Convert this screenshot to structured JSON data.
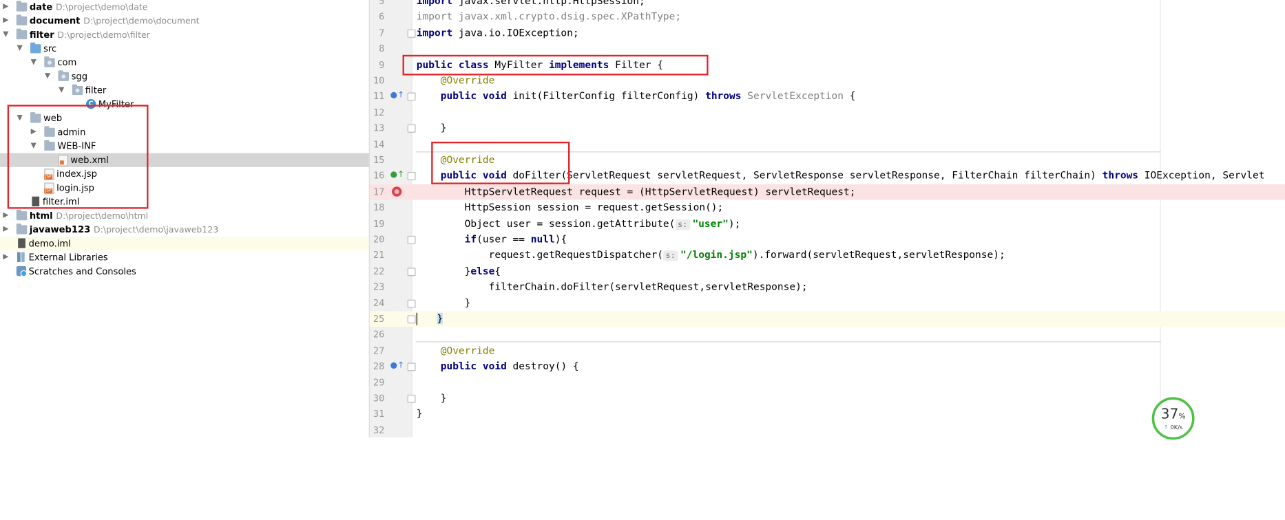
{
  "tree": [
    {
      "type": "module",
      "name": "date",
      "path": "D:\\project\\demo\\date"
    },
    {
      "type": "module",
      "name": "document",
      "path": "D:\\project\\demo\\document"
    },
    {
      "type": "module",
      "name": "filter",
      "path": "D:\\project\\demo\\filter"
    },
    {
      "label": "src"
    },
    {
      "label": "com"
    },
    {
      "label": "sgg"
    },
    {
      "label": "filter"
    },
    {
      "label": "MyFilter"
    },
    {
      "label": "web"
    },
    {
      "label": "admin"
    },
    {
      "label": "WEB-INF"
    },
    {
      "label": "web.xml"
    },
    {
      "label": "index.jsp"
    },
    {
      "label": "login.jsp"
    },
    {
      "label": "filter.iml"
    },
    {
      "type": "module",
      "name": "html",
      "path": "D:\\project\\demo\\html"
    },
    {
      "type": "module",
      "name": "javaweb123",
      "path": "D:\\project\\demo\\javaweb123"
    },
    {
      "label": "demo.iml"
    },
    {
      "label": "External Libraries"
    },
    {
      "label": "Scratches and Consoles"
    }
  ],
  "code": {
    "line_numbers": [
      "5",
      "6",
      "7",
      "8",
      "9",
      "10",
      "11",
      "12",
      "13",
      "14",
      "15",
      "16",
      "17",
      "18",
      "19",
      "20",
      "21",
      "22",
      "23",
      "24",
      "25",
      "26",
      "27",
      "28",
      "29",
      "30",
      "31",
      "32"
    ],
    "l5": {
      "kw": "import",
      "rest": " javax.servlet.http.HttpSession;"
    },
    "l6": {
      "kw": "import",
      "rest": " javax.xml.crypto.dsig.spec.XPathType;"
    },
    "l7": {
      "kw": "import",
      "rest": " java.io.IOException;"
    },
    "l9": {
      "kw1": "public class",
      "name": " MyFilter ",
      "kw2": "implements",
      "rest": " Filter {"
    },
    "l10": {
      "ann": "@Override"
    },
    "l11": {
      "kw": "public void",
      "mid": " init(FilterConfig filterConfig) ",
      "kw2": "throws",
      "gray": " ServletException",
      "rest": " {"
    },
    "l13": "}",
    "l15": {
      "ann": "@Override"
    },
    "l16": {
      "kw": "public void",
      "mid": " doFilter(ServletRequest servletRequest, ServletResponse servletResponse, FilterChain filterChain) ",
      "kw2": "throws",
      "rest": " IOException, Servlet"
    },
    "l17": "HttpServletRequest request = (HttpServletRequest) servletRequest;",
    "l18": "HttpSession session = request.getSession();",
    "l19": {
      "pre": "Object user = session.getAttribute(",
      "hint": "s:",
      "str": "\"user\"",
      "post": ");"
    },
    "l20": {
      "kw": "if",
      "mid": "(user == ",
      "kw2": "null",
      "post": "){"
    },
    "l21": {
      "pre": "request.getRequestDispatcher(",
      "hint": "s:",
      "str": "\"/login.jsp\"",
      "post": ").forward(servletRequest,servletResponse);"
    },
    "l22": {
      "pre": "}",
      "kw": "else",
      "post": "{"
    },
    "l23": "filterChain.doFilter(servletRequest,servletResponse);",
    "l24": "}",
    "l25": "}",
    "l27": {
      "ann": "@Override"
    },
    "l28": {
      "kw": "public void",
      "rest": " destroy() {"
    },
    "l30": "}",
    "l31": "}"
  },
  "network": {
    "percent": "37",
    "unit": "%",
    "speed": "0K/s",
    "up_arrow": "↑"
  },
  "colors": {
    "annotation_box": "#e1252b",
    "keyword": "#000080",
    "string": "#008000",
    "annotation": "#808000",
    "error_line": "#fbe3e3"
  }
}
